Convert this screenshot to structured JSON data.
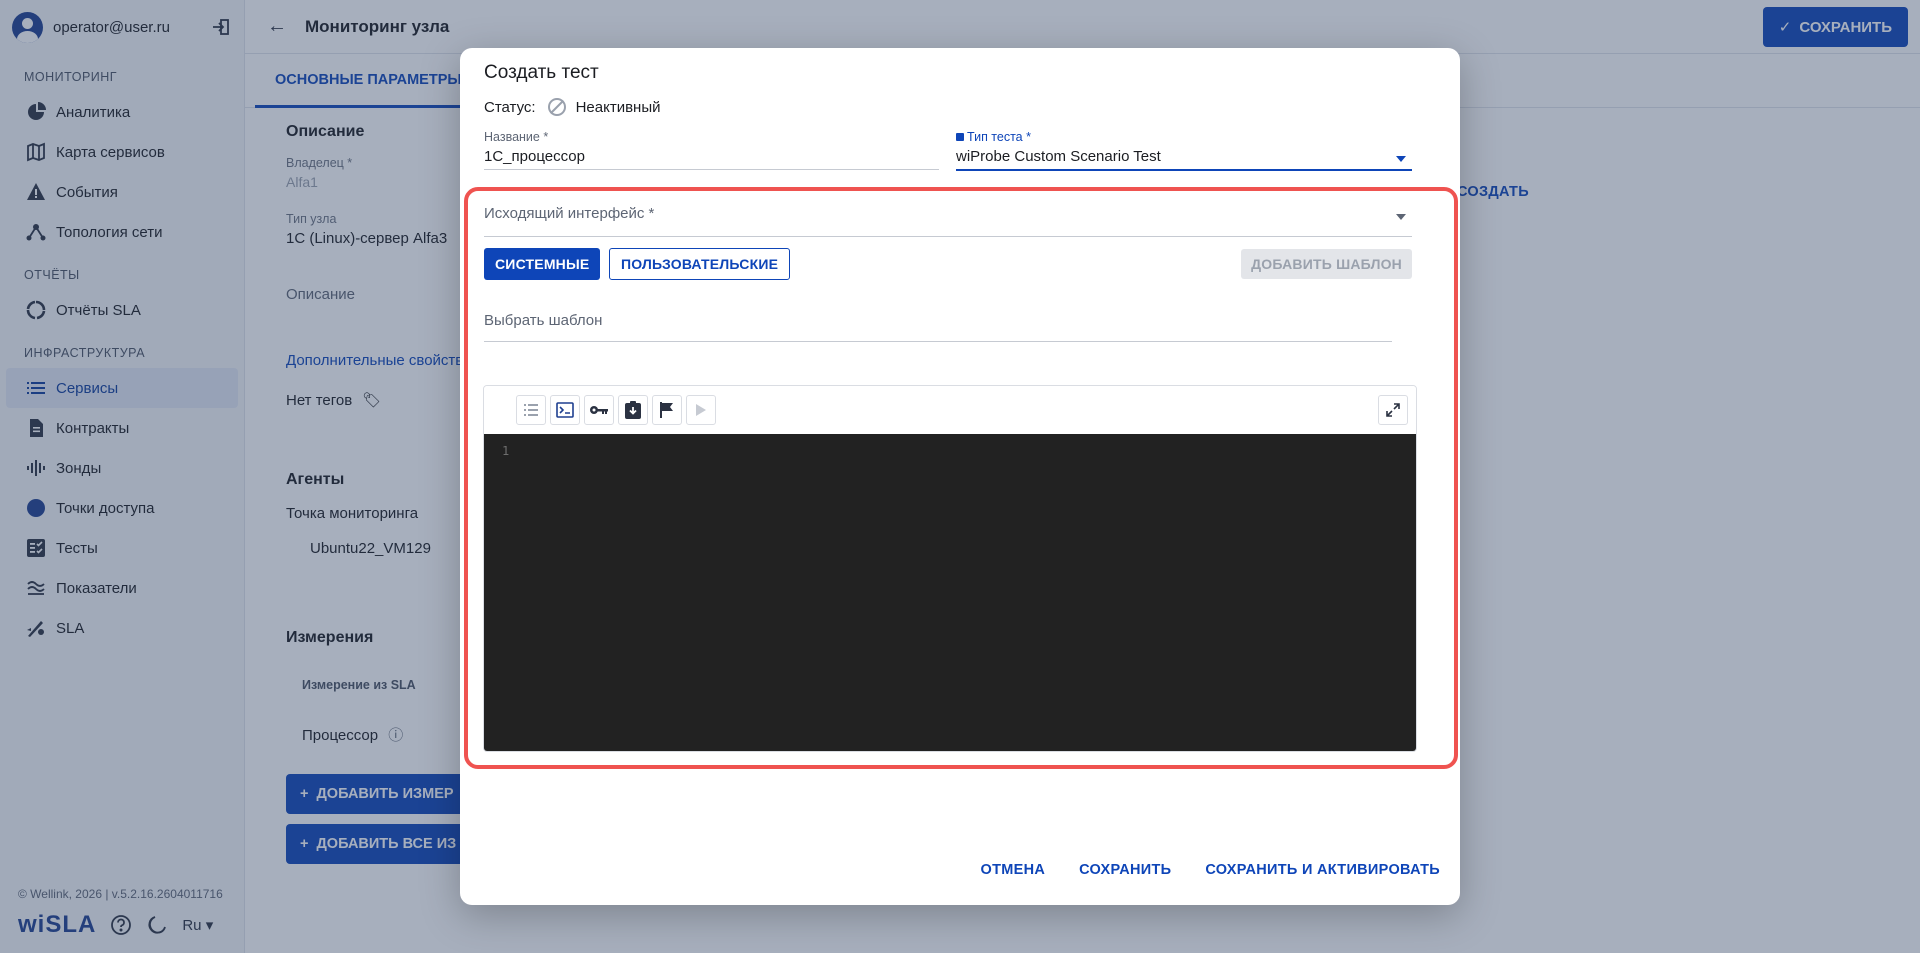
{
  "user": {
    "email": "operator@user.ru"
  },
  "sidebar": {
    "sections": [
      {
        "title": "МОНИТОРИНГ",
        "items": [
          {
            "label": "Аналитика",
            "icon": "pie-chart-icon"
          },
          {
            "label": "Карта сервисов",
            "icon": "map-icon"
          },
          {
            "label": "События",
            "icon": "warning-icon"
          },
          {
            "label": "Топология сети",
            "icon": "topology-icon"
          }
        ]
      },
      {
        "title": "ОТЧЁТЫ",
        "items": [
          {
            "label": "Отчёты SLA",
            "icon": "report-circle-icon"
          }
        ]
      },
      {
        "title": "ИНФРАСТРУКТУРА",
        "items": [
          {
            "label": "Сервисы",
            "icon": "list-icon",
            "active": true
          },
          {
            "label": "Контракты",
            "icon": "document-icon"
          },
          {
            "label": "Зонды",
            "icon": "probe-wave-icon"
          },
          {
            "label": "Точки доступа",
            "icon": "dot-circle-icon"
          },
          {
            "label": "Тесты",
            "icon": "checklist-icon"
          },
          {
            "label": "Показатели",
            "icon": "metrics-icon"
          },
          {
            "label": "SLA",
            "icon": "sla-icon"
          }
        ]
      }
    ],
    "footer": {
      "copyright": "© Wellink, 2026 | v.5.2.16.2604011716",
      "logo": "wiSLA",
      "lang": "Ru"
    }
  },
  "page": {
    "title": "Мониторинг узла",
    "save_label": "СОХРАНИТЬ",
    "tab_label": "ОСНОВНЫЕ ПАРАМЕТРЫ",
    "description": {
      "heading": "Описание",
      "owner_label": "Владелец *",
      "owner_value": "Alfa1",
      "node_type_label": "Тип узла",
      "node_type_value": "1С (Linux)-сервер Alfa3",
      "description_label": "Описание",
      "extra_props": "Дополнительные свойства",
      "no_tags": "Нет тегов"
    },
    "right_create": "СОЗДАТЬ",
    "agents": {
      "heading": "Агенты",
      "point_label": "Точка мониторинга",
      "point_value": "Ubuntu22_VM129"
    },
    "measurements": {
      "heading": "Измерения",
      "column": "Измерение из SLA",
      "row": "Процессор",
      "add_button": "ДОБАВИТЬ ИЗМЕР",
      "add_all_button": "ДОБАВИТЬ ВСЕ ИЗ"
    }
  },
  "modal": {
    "title": "Создать тест",
    "status_label": "Статус:",
    "status_value": "Неактивный",
    "name_label": "Название *",
    "name_value": "1С_процессор",
    "type_label": "Тип теста *",
    "type_value": "wiProbe Custom Scenario Test",
    "source_iface_label": "Исходящий интерфейс *",
    "btn_system": "СИСТЕМНЫЕ",
    "btn_user": "ПОЛЬЗОВАТЕЛЬСКИЕ",
    "btn_add_template": "ДОБАВИТЬ ШАБЛОН",
    "template_placeholder": "Выбрать шаблон",
    "editor": {
      "toolbar": [
        "list-icon",
        "terminal-icon",
        "key-icon",
        "clipboard-download-icon",
        "flag-icon",
        "play-icon"
      ],
      "line_number": "1"
    },
    "actions": {
      "cancel": "ОТМЕНА",
      "save": "СОХРАНИТЬ",
      "save_activate": "СОХРАНИТЬ И АКТИВИРОВАТЬ"
    }
  },
  "colors": {
    "primary": "#0e45b8",
    "highlight": "#ef5350",
    "editor_bg": "#222222"
  }
}
